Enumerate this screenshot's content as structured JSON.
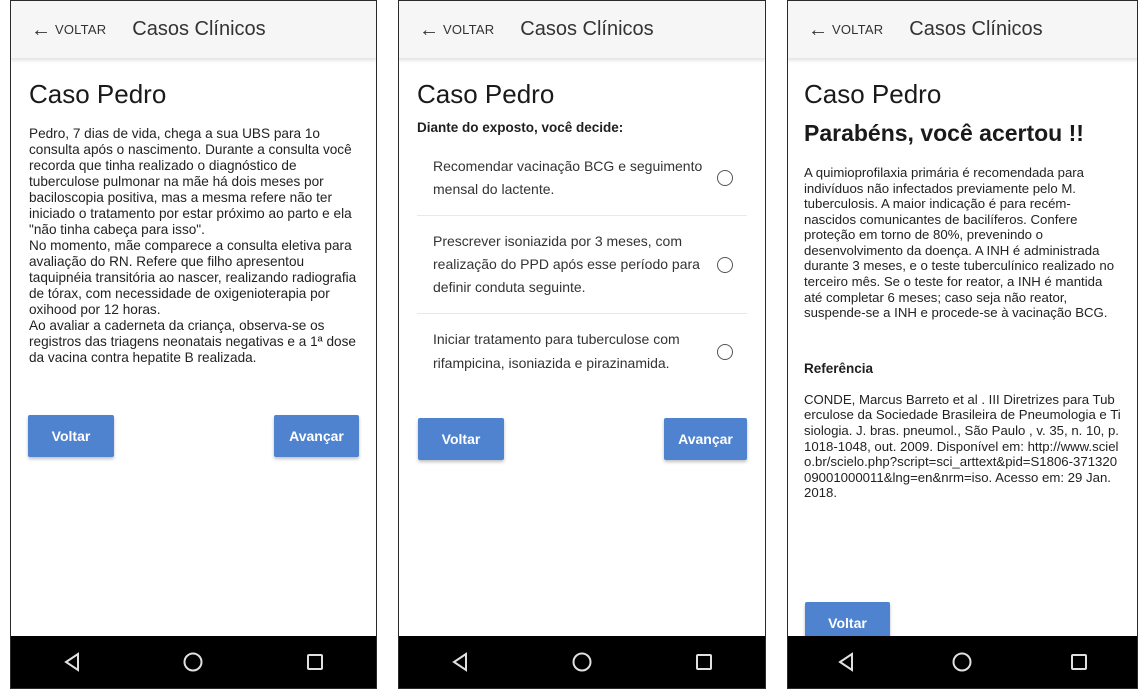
{
  "appbar": {
    "back_label": "VOLTAR",
    "back_icon": "arrow-left-icon",
    "title": "Casos Clínicos"
  },
  "screen1": {
    "case_title": "Caso Pedro",
    "paragraphs": [
      "Pedro, 7 dias de vida, chega a sua UBS para 1o consulta após o nascimento. Durante a consulta você recorda que tinha realizado o diagnóstico de tuberculose pulmonar na mãe há dois meses por baciloscopia positiva, mas a mesma refere não ter iniciado o tratamento por estar próximo ao parto e ela \"não tinha cabeça para isso\".",
      "No momento, mãe comparece a consulta eletiva para avaliação do RN. Refere que filho apresentou taquipnéia transitória ao nascer, realizando radiografia de tórax, com necessidade de oxigenioterapia por oxihood por 12 horas.",
      "Ao avaliar a caderneta da criança, observa-se os registros das triagens neonatais negativas e a 1ª dose da vacina contra hepatite B realizada."
    ],
    "back_button": "Voltar",
    "next_button": "Avançar"
  },
  "screen2": {
    "case_title": "Caso Pedro",
    "question": "Diante do exposto, você decide:",
    "options": [
      "Recomendar vacinação BCG e seguimento mensal do lactente.",
      "Prescrever isoniazida por 3 meses, com realização do PPD após esse período para definir conduta seguinte.",
      "Iniciar tratamento para tuberculose com rifampicina, isoniazida e pirazinamida."
    ],
    "back_button": "Voltar",
    "next_button": "Avançar"
  },
  "screen3": {
    "case_title": "Caso Pedro",
    "success_title": "Parabéns, você acertou !!",
    "explanation": "A quimioprofilaxia primária é recomendada para indivíduos não infectados previamente pelo M. tuberculosis. A maior indicação é para recém-nascidos comunicantes de bacilíferos. Confere proteção em torno de 80%, prevenindo o desenvolvimento da doença. A INH é administrada durante 3 meses, e o teste tuberculínico realizado no terceiro mês. Se o teste for reator, a INH é mantida até completar 6 meses; caso seja não reator, suspende-se a INH e procede-se à vacinação BCG.",
    "reference_heading": "Referência",
    "reference_text": "CONDE, Marcus Barreto et al . III Diretrizes para Tuberculose da Sociedade Brasileira de Pneumologia e Tisiologia. J. bras. pneumol., São Paulo , v. 35, n. 10, p. 1018-1048, out. 2009. Disponível em: http://www.scielo.br/scielo.php?script=sci_arttext&pid=S1806-37132009001000011&lng=en&nrm=iso. Acesso em: 29 Jan. 2018.",
    "back_button": "Voltar"
  },
  "navbar": {
    "icons": [
      "back-triangle-icon",
      "home-circle-icon",
      "recents-square-icon"
    ]
  },
  "colors": {
    "button": "#4f83cf",
    "navbar": "#000000",
    "appbar": "#f6f6f6"
  }
}
